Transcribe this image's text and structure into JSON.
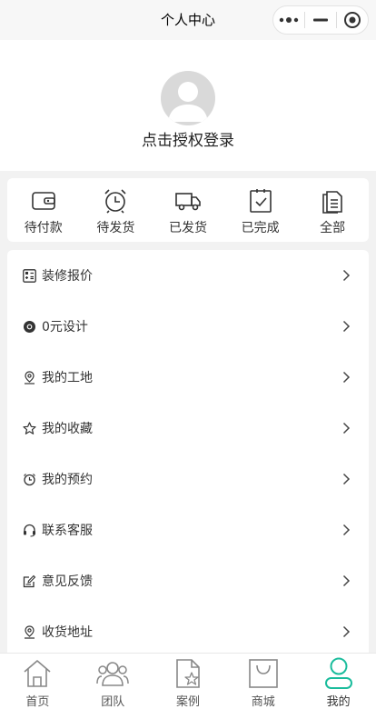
{
  "navbar": {
    "title": "个人中心",
    "capsule": {
      "more_icon": "more-dots-icon",
      "minimize_icon": "minimize-icon",
      "close_icon": "target-circle-icon"
    }
  },
  "profile": {
    "avatar_icon": "default-avatar-icon",
    "login_text": "点击授权登录"
  },
  "orders": [
    {
      "label": "待付款",
      "icon": "wallet-icon"
    },
    {
      "label": "待发货",
      "icon": "alarm-clock-icon"
    },
    {
      "label": "已发货",
      "icon": "truck-icon"
    },
    {
      "label": "已完成",
      "icon": "clipboard-check-icon"
    },
    {
      "label": "全部",
      "icon": "documents-icon"
    }
  ],
  "menu": [
    {
      "label": "装修报价",
      "icon": "calculator-icon"
    },
    {
      "label": "0元设计",
      "icon": "design-badge-icon"
    },
    {
      "label": "我的工地",
      "icon": "location-pin-icon"
    },
    {
      "label": "我的收藏",
      "icon": "star-icon"
    },
    {
      "label": "我的预约",
      "icon": "alarm-clock-icon"
    },
    {
      "label": "联系客服",
      "icon": "headset-icon"
    },
    {
      "label": "意见反馈",
      "icon": "edit-note-icon"
    },
    {
      "label": "收货地址",
      "icon": "location-pin-icon"
    }
  ],
  "tabbar": [
    {
      "label": "首页",
      "icon": "home-icon"
    },
    {
      "label": "团队",
      "icon": "team-icon"
    },
    {
      "label": "案例",
      "icon": "case-document-icon"
    },
    {
      "label": "商城",
      "icon": "shopping-bag-icon"
    },
    {
      "label": "我的",
      "icon": "user-icon",
      "active": true
    }
  ],
  "colors": {
    "accent": "#1abc9c",
    "background": "#f2f2f2",
    "card": "#ffffff"
  }
}
